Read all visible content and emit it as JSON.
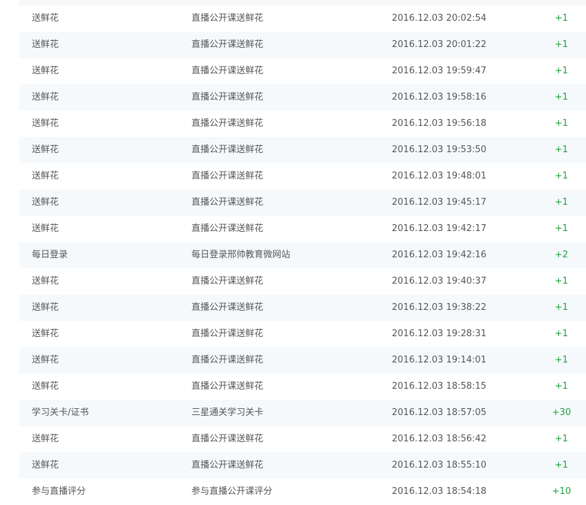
{
  "rows": [
    {
      "type": "送鲜花",
      "desc": "直播公开课送鲜花",
      "time": "2016.12.03 20:02:54",
      "points": "+1"
    },
    {
      "type": "送鲜花",
      "desc": "直播公开课送鲜花",
      "time": "2016.12.03 20:01:22",
      "points": "+1"
    },
    {
      "type": "送鲜花",
      "desc": "直播公开课送鲜花",
      "time": "2016.12.03 19:59:47",
      "points": "+1"
    },
    {
      "type": "送鲜花",
      "desc": "直播公开课送鲜花",
      "time": "2016.12.03 19:58:16",
      "points": "+1"
    },
    {
      "type": "送鲜花",
      "desc": "直播公开课送鲜花",
      "time": "2016.12.03 19:56:18",
      "points": "+1"
    },
    {
      "type": "送鲜花",
      "desc": "直播公开课送鲜花",
      "time": "2016.12.03 19:53:50",
      "points": "+1"
    },
    {
      "type": "送鲜花",
      "desc": "直播公开课送鲜花",
      "time": "2016.12.03 19:48:01",
      "points": "+1"
    },
    {
      "type": "送鲜花",
      "desc": "直播公开课送鲜花",
      "time": "2016.12.03 19:45:17",
      "points": "+1"
    },
    {
      "type": "送鲜花",
      "desc": "直播公开课送鲜花",
      "time": "2016.12.03 19:42:17",
      "points": "+1"
    },
    {
      "type": "每日登录",
      "desc": "每日登录邢帅教育微网站",
      "time": "2016.12.03 19:42:16",
      "points": "+2"
    },
    {
      "type": "送鲜花",
      "desc": "直播公开课送鲜花",
      "time": "2016.12.03 19:40:37",
      "points": "+1"
    },
    {
      "type": "送鲜花",
      "desc": "直播公开课送鲜花",
      "time": "2016.12.03 19:38:22",
      "points": "+1"
    },
    {
      "type": "送鲜花",
      "desc": "直播公开课送鲜花",
      "time": "2016.12.03 19:28:31",
      "points": "+1"
    },
    {
      "type": "送鲜花",
      "desc": "直播公开课送鲜花",
      "time": "2016.12.03 19:14:01",
      "points": "+1"
    },
    {
      "type": "送鲜花",
      "desc": "直播公开课送鲜花",
      "time": "2016.12.03 18:58:15",
      "points": "+1"
    },
    {
      "type": "学习关卡/证书",
      "desc": "三星通关学习关卡",
      "time": "2016.12.03 18:57:05",
      "points": "+30"
    },
    {
      "type": "送鲜花",
      "desc": "直播公开课送鲜花",
      "time": "2016.12.03 18:56:42",
      "points": "+1"
    },
    {
      "type": "送鲜花",
      "desc": "直播公开课送鲜花",
      "time": "2016.12.03 18:55:10",
      "points": "+1"
    },
    {
      "type": "参与直播评分",
      "desc": "参与直播公开课评分",
      "time": "2016.12.03 18:54:18",
      "points": "+10"
    }
  ]
}
